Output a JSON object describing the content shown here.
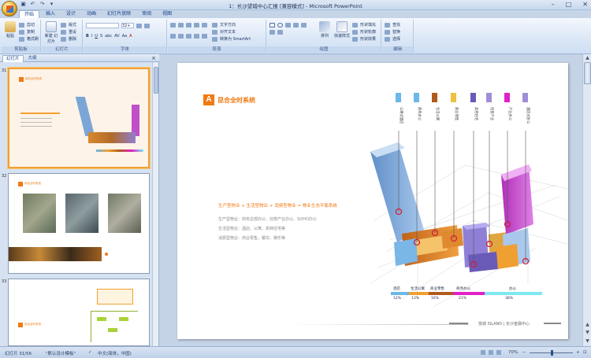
{
  "window": {
    "title": "1：长沙望城中心汇报 [兼容模式] - Microsoft PowerPoint",
    "minimize": "–",
    "maximize": "□",
    "close": "✕"
  },
  "quick_access": [
    "▣",
    "↶",
    "↷",
    "▾"
  ],
  "ribbon_tabs": [
    "开始",
    "插入",
    "设计",
    "动画",
    "幻灯片放映",
    "审阅",
    "视图"
  ],
  "ribbon": {
    "clipboard": {
      "paste": "粘贴",
      "cut": "剪切",
      "copy": "复制",
      "format_painter": "格式刷",
      "label": "剪贴板"
    },
    "slides": {
      "new_slide": "新建\n幻灯片",
      "layout": "版式",
      "reset": "重设",
      "delete": "删除",
      "label": "幻灯片"
    },
    "font": {
      "font_name": "",
      "font_size": "32+",
      "label": "字体",
      "buttons": [
        "B",
        "I",
        "U",
        "S",
        "abc",
        "AV",
        "Aa",
        "A"
      ]
    },
    "paragraph": {
      "text_direction": "文字方向",
      "align_text": "对齐文本",
      "smartart": "转换为 SmartArt",
      "label": "段落"
    },
    "drawing": {
      "arrange": "排列",
      "quick_styles": "快速样式",
      "shape_fill": "形状填充",
      "shape_outline": "形状轮廓",
      "shape_effects": "形状效果",
      "label": "绘图"
    },
    "editing": {
      "find": "查找",
      "replace": "替换",
      "select": "选择",
      "label": "编辑"
    }
  },
  "left_panel": {
    "tabs": [
      "幻灯片",
      "大纲"
    ],
    "close": "×",
    "thumbs": [
      {
        "num": "31",
        "title": "综合全时系统"
      },
      {
        "num": "32",
        "title": "综合全时系统"
      },
      {
        "num": "33",
        "title": "综合全时系统"
      }
    ]
  },
  "slide": {
    "badge": "A",
    "title": "昆合全时系统",
    "headline": "生产型物业 + 生活型物业 + 消费型物业 = 物业生态平衡系统",
    "lines": [
      "生产型物业：商务总部办公、创意产业办公、SOHO办公",
      "生活型物业：酒店、公寓、高档住宅等",
      "消费型物业：商业零售、餐饮、娱乐等"
    ],
    "footer": "悦城 ISLAND | 长沙金融中心",
    "legend": [
      {
        "label": "酒店",
        "pct": "12%",
        "color": "#6bb8e8"
      },
      {
        "label": "生活公寓",
        "pct": "13%",
        "color": "#f0a030"
      },
      {
        "label": "商业零售",
        "pct": "16%",
        "color": "#b05a1c"
      },
      {
        "label": "商务办公",
        "pct": "21%",
        "color": "#e020c8"
      },
      {
        "label": "办公",
        "pct": "38%",
        "color": "#7fe8f2"
      }
    ],
    "callouts": [
      "公寓式酒店",
      "商务办公",
      "生活公寓",
      "商业零售",
      "高档住宅",
      "创意产业",
      "产业办公",
      "酒店式办公"
    ],
    "callout_colors": [
      "#6bb8e8",
      "#6bb8e8",
      "#b05a1c",
      "#f0c040",
      "#6a5ab8",
      "#a08ed8",
      "#e020c8",
      "#a08ed8"
    ]
  },
  "status": {
    "slide": "幻灯片 31/56",
    "theme": "\"默认设计模板\"",
    "lang": "中文(简体，中国)",
    "zoom": "70%"
  }
}
